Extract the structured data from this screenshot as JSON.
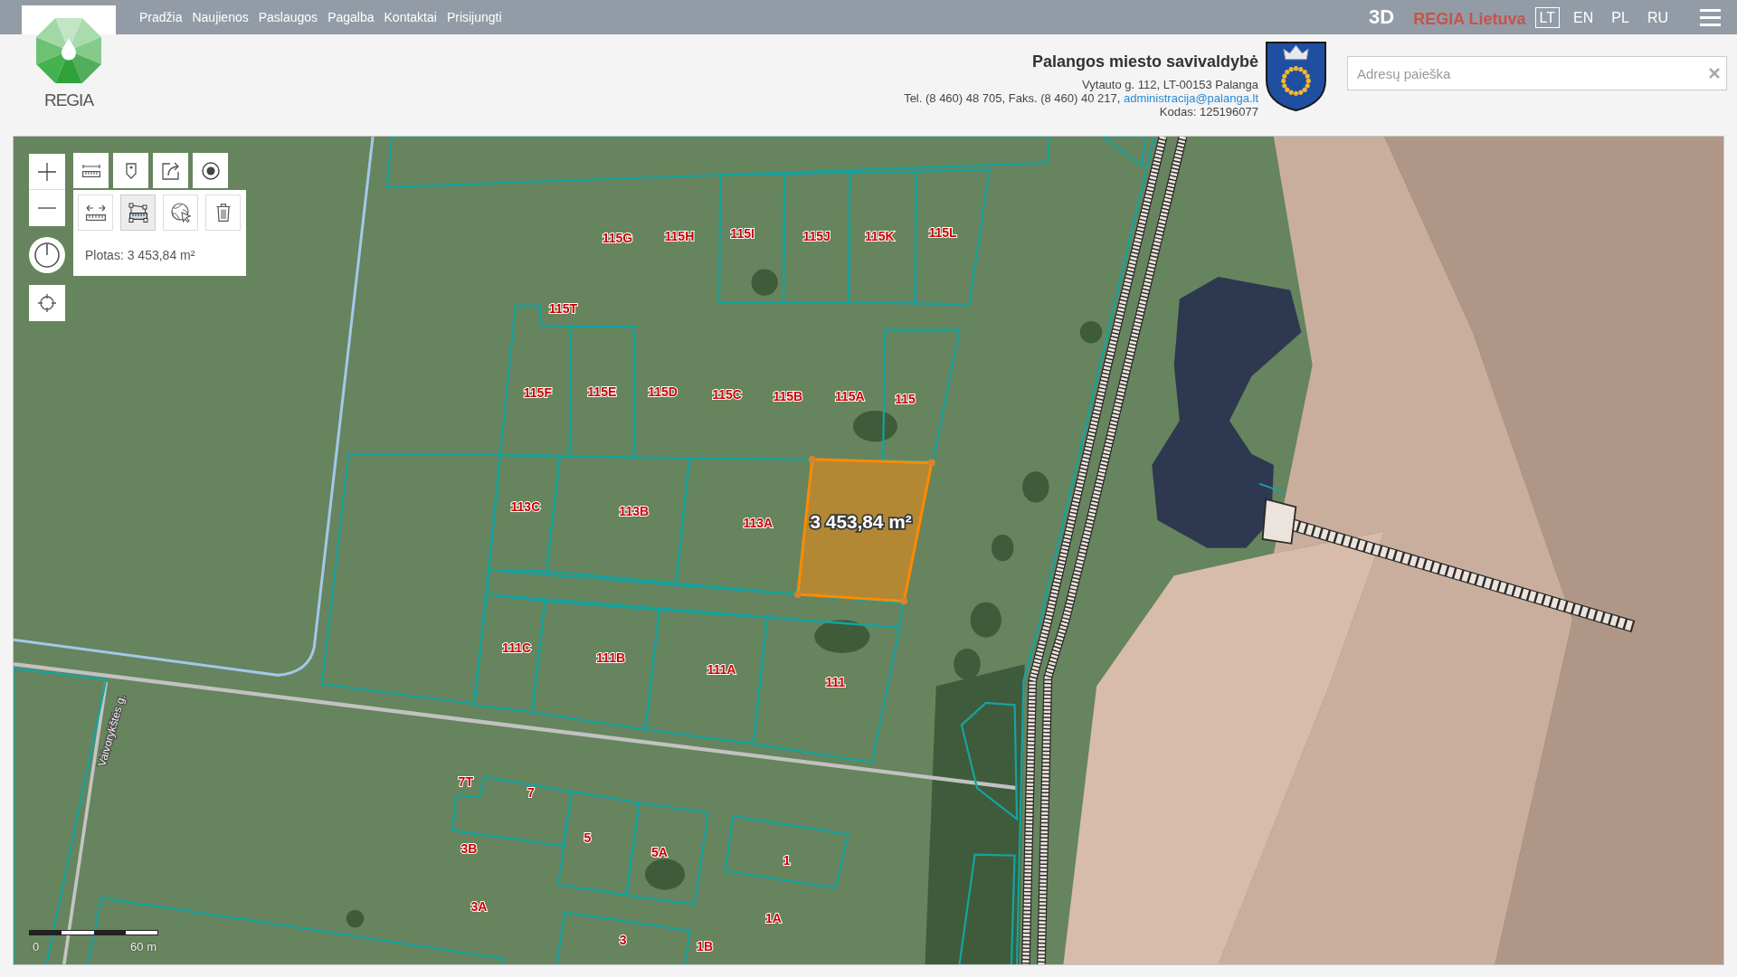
{
  "top_bar": {
    "nav": [
      "Pradžia",
      "Naujienos",
      "Paslaugos",
      "Pagalba",
      "Kontaktai",
      "Prisijungti"
    ],
    "mode_3d": "3D",
    "brand": "REGIA Lietuva",
    "languages": [
      {
        "label": "LT",
        "selected": true
      },
      {
        "label": "EN",
        "selected": false
      },
      {
        "label": "PL",
        "selected": false
      },
      {
        "label": "RU",
        "selected": false
      }
    ]
  },
  "logo": {
    "text": "REGIA"
  },
  "municipality": {
    "name": "Palangos miesto savivaldybė",
    "address": "Vytauto g. 112, LT-00153 Palanga",
    "phone_fax": "Tel. (8 460) 48 705, Faks. (8 460) 40 217,",
    "email": "administracija@palanga.lt",
    "code": "Kodas: 125196077"
  },
  "search": {
    "placeholder": "Adresų paieška"
  },
  "map": {
    "measure_panel": {
      "tools": [
        {
          "selected": false
        },
        {
          "selected": true
        },
        {
          "selected": false
        },
        {
          "selected": false
        }
      ],
      "result": "Plotas: 3 453,84 m²"
    },
    "parcel_labels": [
      "115G",
      "115H",
      "115I",
      "115J",
      "115K",
      "115L",
      "115T",
      "115F",
      "115E",
      "115D",
      "115C",
      "115B",
      "115A",
      "115",
      "113C",
      "113B",
      "113A",
      "111C",
      "111B",
      "111A",
      "111",
      "7T",
      "7",
      "3B",
      "5",
      "5A",
      "1",
      "3A",
      "1A",
      "3",
      "1B"
    ],
    "street_label": "Vaivorykštės g.",
    "measured_area": "3 453,84 m²",
    "scale": {
      "start": "0",
      "end": "60 m"
    }
  }
}
